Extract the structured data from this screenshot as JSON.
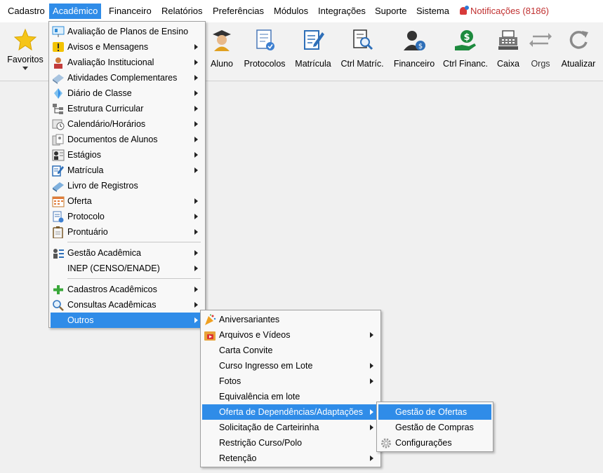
{
  "menubar": {
    "items": [
      "Cadastro",
      "Acadêmico",
      "Financeiro",
      "Relatórios",
      "Preferências",
      "Módulos",
      "Integrações",
      "Suporte",
      "Sistema"
    ],
    "notifications": "Notificações (8186)"
  },
  "toolbar": {
    "favoritos": "Favoritos",
    "buttons": [
      "Aluno",
      "Protocolos",
      "Matrícula",
      "Ctrl Matríc.",
      "Financeiro",
      "Ctrl Financ.",
      "Caixa",
      "Orgs",
      "Atualizar"
    ]
  },
  "academico_menu": {
    "items": [
      "Avaliação de Planos de Ensino",
      "Avisos e Mensagens",
      "Avaliação Institucional",
      "Atividades Complementares",
      "Diário de Classe",
      "Estrutura Curricular",
      "Calendário/Horários",
      "Documentos de Alunos",
      "Estágios",
      "Matrícula",
      "Livro de Registros",
      "Oferta",
      "Protocolo",
      "Prontuário",
      "Gestão Acadêmica",
      "INEP (CENSO/ENADE)",
      "Cadastros Acadêmicos",
      "Consultas Acadêmicas",
      "Outros"
    ]
  },
  "outros_menu": {
    "items": [
      "Aniversariantes",
      "Arquivos e Vídeos",
      "Carta Convite",
      "Curso Ingresso em Lote",
      "Fotos",
      "Equivalência em lote",
      "Oferta de Dependências/Adaptações",
      "Solicitação de Carteirinha",
      "Restrição Curso/Polo",
      "Retenção"
    ]
  },
  "oferta_menu": {
    "items": [
      "Gestão de Ofertas",
      "Gestão de Compras",
      "Configurações"
    ]
  },
  "colors": {
    "highlight": "#2f8ce8",
    "notification": "#c03030"
  }
}
